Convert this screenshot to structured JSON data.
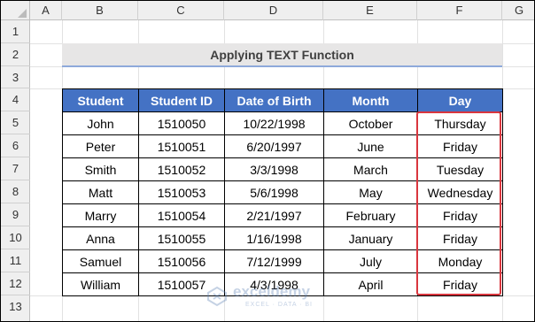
{
  "columns": [
    "A",
    "B",
    "C",
    "D",
    "E",
    "F",
    "G"
  ],
  "rows": [
    "1",
    "2",
    "3",
    "4",
    "5",
    "6",
    "7",
    "8",
    "9",
    "10",
    "11",
    "12",
    "13"
  ],
  "title": "Applying TEXT Function",
  "table": {
    "headers": [
      "Student",
      "Student ID",
      "Date of Birth",
      "Month",
      "Day"
    ],
    "rows": [
      [
        "John",
        "1510050",
        "10/22/1998",
        "October",
        "Thursday"
      ],
      [
        "Peter",
        "1510051",
        "6/20/1997",
        "June",
        "Friday"
      ],
      [
        "Smith",
        "1510052",
        "3/3/1998",
        "March",
        "Tuesday"
      ],
      [
        "Matt",
        "1510053",
        "5/6/1998",
        "May",
        "Wednesday"
      ],
      [
        "Marry",
        "1510054",
        "2/21/1997",
        "February",
        "Friday"
      ],
      [
        "Anna",
        "1510055",
        "1/16/1998",
        "January",
        "Friday"
      ],
      [
        "Samuel",
        "1510056",
        "7/12/1999",
        "July",
        "Monday"
      ],
      [
        "William",
        "1510057",
        "4/3/1998",
        "April",
        "Friday"
      ]
    ]
  },
  "highlight_color": "#d9363e",
  "header_color": "#4472c4",
  "watermark": {
    "name": "exceldemy",
    "tagline": "EXCEL · DATA · BI"
  }
}
